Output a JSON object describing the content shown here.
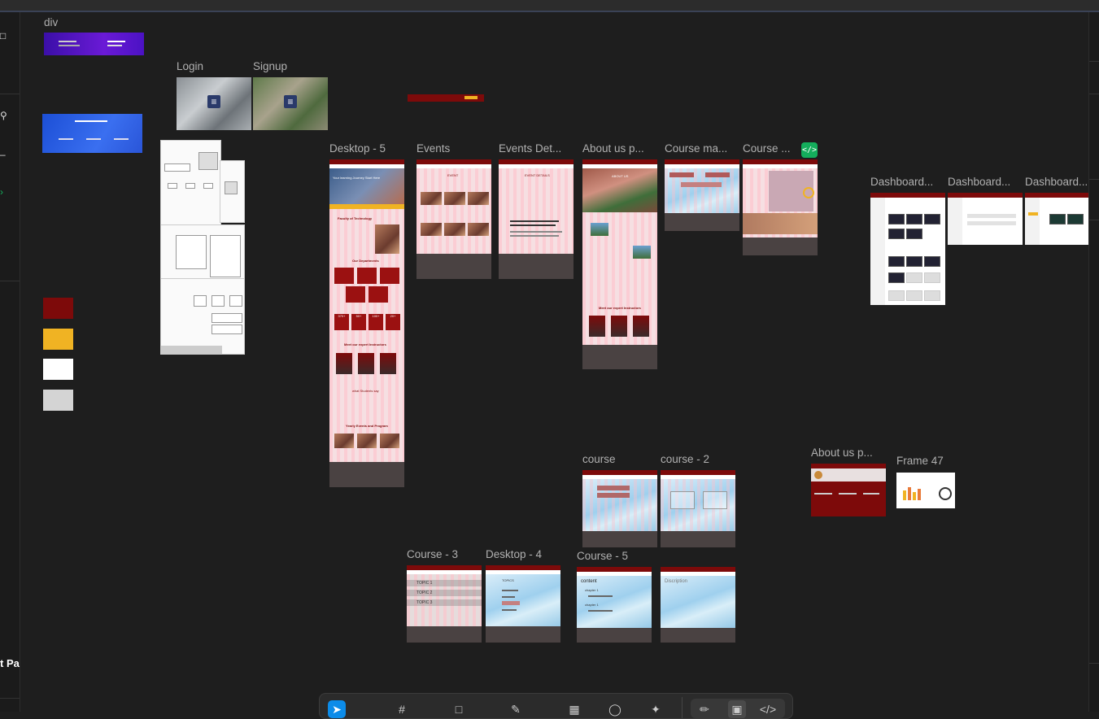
{
  "canvas": {
    "frame_labels": {
      "div": "div",
      "login": "Login",
      "signup": "Signup",
      "desktop5": "Desktop - 5",
      "events": "Events",
      "events_detail": "Events Det...",
      "about_us": "About us p...",
      "course_ma": "Course ma...",
      "course_dots": "Course ...",
      "dashboard1": "Dashboard...",
      "dashboard2": "Dashboard...",
      "dashboard3": "Dashboard...",
      "course": "course",
      "course2": "course - 2",
      "about_us2": "About us p...",
      "frame47": "Frame 47",
      "course3": "Course - 3",
      "desktop4": "Desktop - 4",
      "course5": "Course - 5"
    },
    "frame_text": {
      "faculty_title": "Faculty of Technology",
      "departments": "Our Departments",
      "stat1": "370+",
      "stat2": "50+",
      "stat3": "100+",
      "stat4": "20+",
      "instructors": "Meet our expert Instructors",
      "students_say": "what Students say",
      "yearly_events": "Yearly Events and Program",
      "hero": "Your learning Journey Start Here",
      "event": "EVENT",
      "event_details": "EVENT DETAILS",
      "about": "ABOUT US",
      "topic1": "TOPIC 1",
      "topic2": "TOPIC 2",
      "topic3": "TOPIC 3",
      "topics": "TOPICS",
      "content": "content",
      "chapter1": "chapter 1",
      "chapter1b": "chapter 1",
      "description": "Discription"
    }
  },
  "left_panel": {
    "partial_label": "t Pa"
  },
  "swatches": [
    "#7d0a0a",
    "#f0b323",
    "#ffffff",
    "#d4d4d4"
  ],
  "colors": {
    "brand_red": "#7d0a0a",
    "accent_yellow": "#f0b323",
    "selection_blue": "#0c8ce9",
    "dev_green": "#14ae5c"
  },
  "toolbar": {
    "tools": [
      "move-tool",
      "frame-tool",
      "shape-tool",
      "pen-tool",
      "text-tool",
      "resources-tool",
      "comment-tool",
      "actions-tool",
      "draw-mode",
      "design-mode",
      "dev-mode"
    ]
  }
}
